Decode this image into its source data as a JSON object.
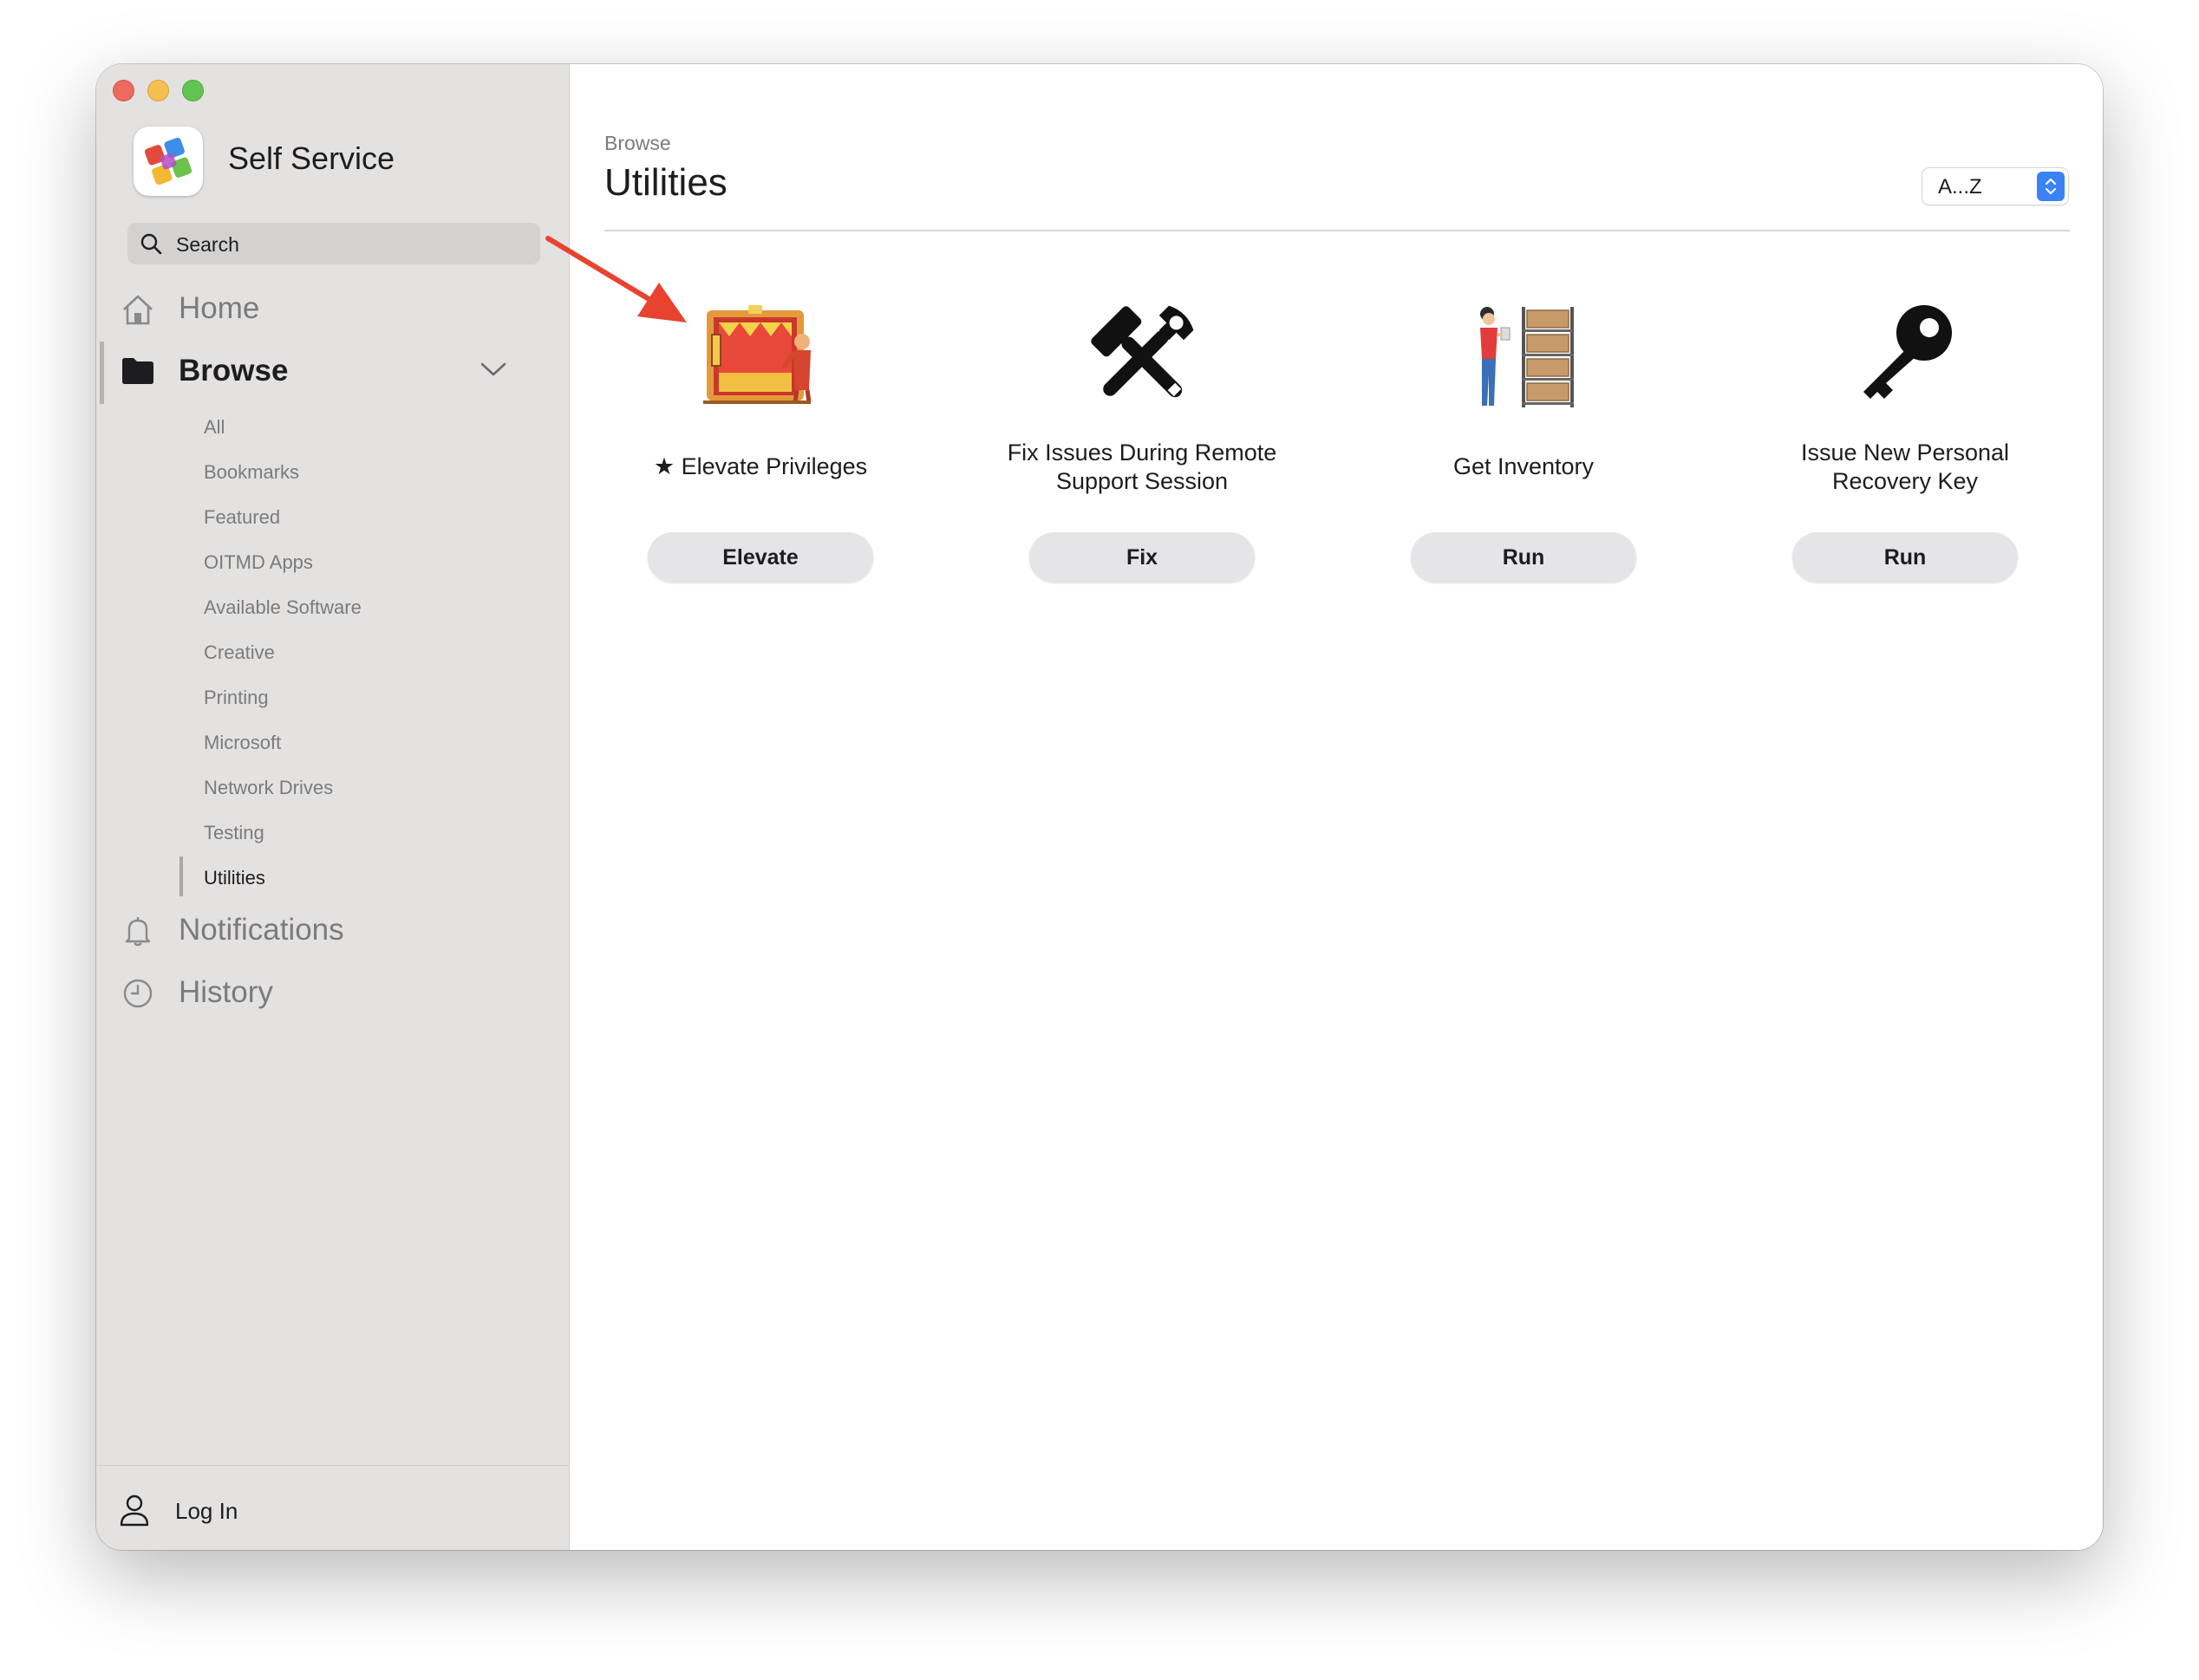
{
  "window": {
    "title": "Self Service"
  },
  "search": {
    "placeholder": "Search"
  },
  "nav": {
    "home": "Home",
    "browse": "Browse",
    "notifications": "Notifications",
    "history": "History"
  },
  "categories": [
    "All",
    "Bookmarks",
    "Featured",
    "OITMD Apps",
    "Available Software",
    "Creative",
    "Printing",
    "Microsoft",
    "Network Drives",
    "Testing",
    "Utilities"
  ],
  "active_category": "Utilities",
  "login": {
    "label": "Log In"
  },
  "main": {
    "breadcrumb": "Browse",
    "title": "Utilities",
    "sort": "A...Z"
  },
  "items": [
    {
      "name": "Elevate Privileges",
      "bookmarked": true,
      "button": "Elevate",
      "icon": "elevator-illustration-icon"
    },
    {
      "name_line1": "Fix Issues During Remote",
      "name_line2": "Support Session",
      "button": "Fix",
      "icon": "wrench-hammer-icon"
    },
    {
      "name": "Get Inventory",
      "button": "Run",
      "icon": "inventory-shelf-icon"
    },
    {
      "name_line1": "Issue New Personal",
      "name_line2": "Recovery Key",
      "button": "Run",
      "icon": "key-icon"
    }
  ],
  "colors": {
    "accent": "#3a82f7",
    "annotation_arrow": "#e8432e",
    "sidebar": "#e3e2e1"
  }
}
